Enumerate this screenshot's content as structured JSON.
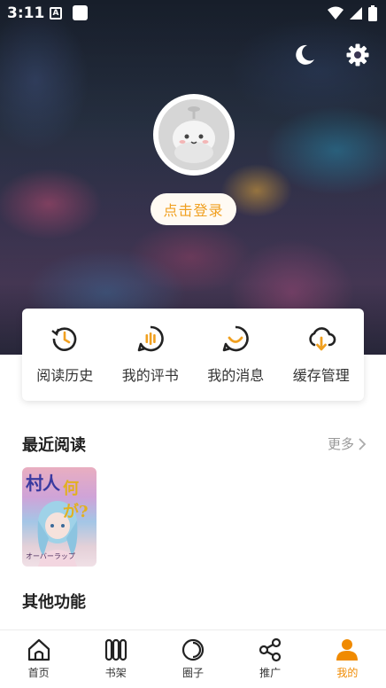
{
  "status_bar": {
    "time": "3:11",
    "a_badge": "A"
  },
  "profile": {
    "login_label": "点击登录"
  },
  "quick_actions": [
    {
      "label": "阅读历史",
      "icon": "history-icon"
    },
    {
      "label": "我的评书",
      "icon": "comment-icon"
    },
    {
      "label": "我的消息",
      "icon": "message-icon"
    },
    {
      "label": "缓存管理",
      "icon": "cloud-download-icon"
    }
  ],
  "recent": {
    "title": "最近阅读",
    "more_label": "更多",
    "book": {
      "cover_title_1": "村人",
      "cover_title_2": "何が?",
      "cover_sub": "オーバーラップ"
    }
  },
  "other": {
    "title": "其他功能"
  },
  "tabs": [
    {
      "label": "首页",
      "icon": "home-icon"
    },
    {
      "label": "书架",
      "icon": "bookshelf-icon"
    },
    {
      "label": "圈子",
      "icon": "circle-icon"
    },
    {
      "label": "推广",
      "icon": "share-icon"
    },
    {
      "label": "我的",
      "icon": "user-icon"
    }
  ],
  "colors": {
    "accent": "#f0a020",
    "active_tab": "#f08a00"
  }
}
